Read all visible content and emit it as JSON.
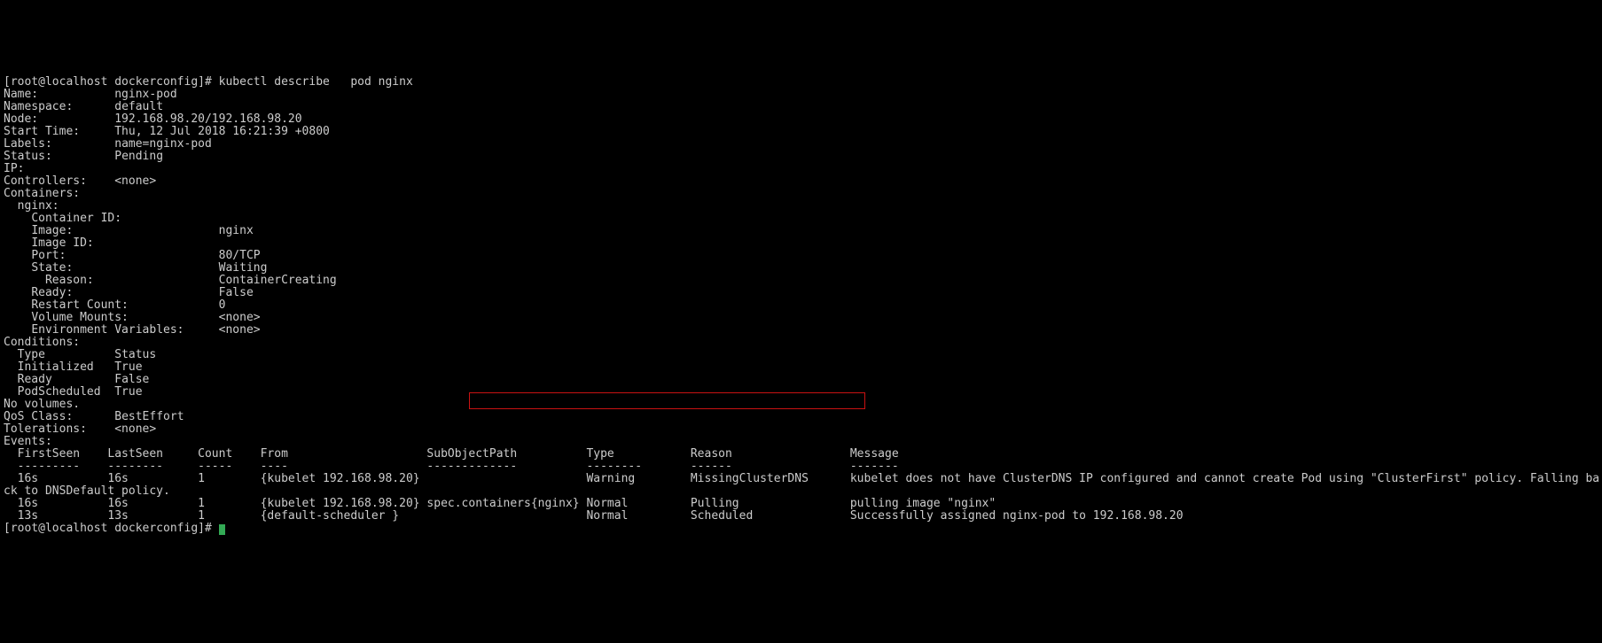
{
  "prompt": "[root@localhost dockerconfig]# ",
  "command": "kubectl describe   pod nginx",
  "fields": {
    "name_label": "Name:",
    "name": "nginx-pod",
    "ns_label": "Namespace:",
    "ns": "default",
    "node_label": "Node:",
    "node": "192.168.98.20/192.168.98.20",
    "start_label": "Start Time:",
    "start": "Thu, 12 Jul 2018 16:21:39 +0800",
    "labels_label": "Labels:",
    "labels": "name=nginx-pod",
    "status_label": "Status:",
    "status": "Pending",
    "ip_label": "IP:",
    "ip": "",
    "ctrl_label": "Controllers:",
    "ctrl": "<none>",
    "containers_label": "Containers:",
    "cname": "nginx:",
    "cid_label": "Container ID:",
    "img_label": "Image:",
    "img": "nginx",
    "imgid_label": "Image ID:",
    "port_label": "Port:",
    "port": "80/TCP",
    "state_label": "State:",
    "state": "Waiting",
    "reason_label": "Reason:",
    "reason": "ContainerCreating",
    "ready_label": "Ready:",
    "ready": "False",
    "rc_label": "Restart Count:",
    "rc": "0",
    "vm_label": "Volume Mounts:",
    "vm": "<none>",
    "env_label": "Environment Variables:",
    "env": "<none>",
    "cond_label": "Conditions:",
    "cond_type": "Type",
    "cond_status": "Status",
    "c1a": "Initialized",
    "c1b": "True",
    "c2a": "Ready",
    "c2b": "False",
    "c3a": "PodScheduled",
    "c3b": "True",
    "novol": "No volumes.",
    "qos_label": "QoS Class:",
    "qos": "BestEffort",
    "tol_label": "Tolerations:",
    "tol": "<none>",
    "events_label": "Events:"
  },
  "event_headers": {
    "first": "FirstSeen",
    "last": "LastSeen",
    "count": "Count",
    "from": "From",
    "sub": "SubObjectPath",
    "type": "Type",
    "reason": "Reason",
    "msg": "Message"
  },
  "event_dashes": {
    "first": "---------",
    "last": "--------",
    "count": "-----",
    "from": "----",
    "sub": "-------------",
    "type": "--------",
    "reason": "------",
    "msg": "-------"
  },
  "events": [
    {
      "first": "16s",
      "last": "16s",
      "count": "1",
      "from": "{kubelet 192.168.98.20}",
      "sub": "",
      "type": "Warning",
      "reason": "MissingClusterDNS",
      "msg": "kubelet does not have ClusterDNS IP configured and cannot create Pod using \"ClusterFirst\" policy. Falling ba",
      "wrap": "ck to DNSDefault policy."
    },
    {
      "first": "16s",
      "last": "16s",
      "count": "1",
      "from": "{kubelet 192.168.98.20}",
      "sub": "spec.containers{nginx}",
      "type": "Normal",
      "reason": "Pulling",
      "msg": "pulling image \"nginx\"",
      "wrap": null
    },
    {
      "first": "13s",
      "last": "13s",
      "count": "1",
      "from": "{default-scheduler }",
      "sub": "",
      "type": "Normal",
      "reason": "Scheduled",
      "msg": "Successfully assigned nginx-pod to 192.168.98.20",
      "wrap": null
    }
  ],
  "prompt2": "[root@localhost dockerconfig]# "
}
